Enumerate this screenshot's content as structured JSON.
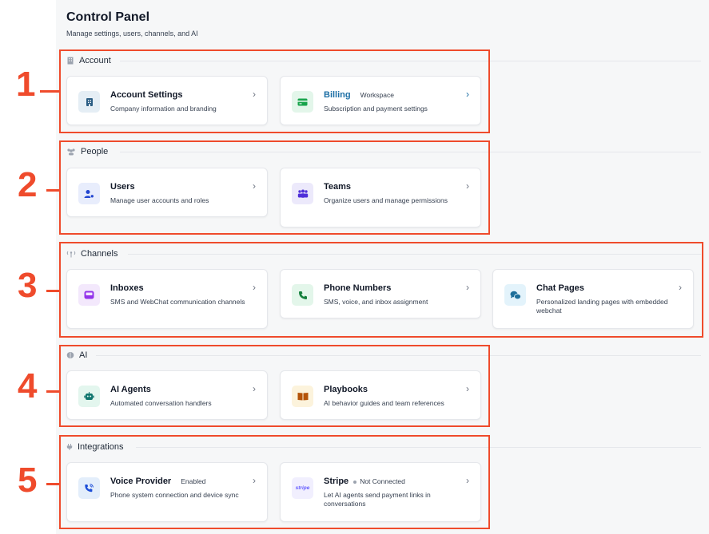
{
  "header": {
    "title": "Control Panel",
    "subtitle": "Manage settings, users, channels, and AI"
  },
  "sections": {
    "account": {
      "label": "Account",
      "cards": [
        {
          "title": "Account Settings",
          "badge": "",
          "desc": "Company information and branding",
          "icon": "building-icon"
        },
        {
          "title": "Billing",
          "badge": "Workspace",
          "desc": "Subscription and payment settings",
          "icon": "credit-card-icon"
        }
      ]
    },
    "people": {
      "label": "People",
      "cards": [
        {
          "title": "Users",
          "desc": "Manage user accounts and roles",
          "icon": "user-gear-icon"
        },
        {
          "title": "Teams",
          "desc": "Organize users and manage permissions",
          "icon": "team-icon"
        }
      ]
    },
    "channels": {
      "label": "Channels",
      "cards": [
        {
          "title": "Inboxes",
          "desc": "SMS and WebChat communication channels",
          "icon": "inbox-icon"
        },
        {
          "title": "Phone Numbers",
          "desc": "SMS, voice, and inbox assignment",
          "icon": "phone-icon"
        },
        {
          "title": "Chat Pages",
          "desc": "Personalized landing pages with embedded webchat",
          "icon": "chat-bubbles-icon"
        }
      ]
    },
    "ai": {
      "label": "AI",
      "cards": [
        {
          "title": "AI Agents",
          "desc": "Automated conversation handlers",
          "icon": "robot-icon"
        },
        {
          "title": "Playbooks",
          "desc": "AI behavior guides and team references",
          "icon": "book-icon"
        }
      ]
    },
    "integrations": {
      "label": "Integrations",
      "cards": [
        {
          "title": "Voice Provider",
          "badge": "Enabled",
          "desc": "Phone system connection and device sync",
          "icon": "phone-wave-icon"
        },
        {
          "title": "Stripe",
          "badge": "Not Connected",
          "desc": "Let AI agents send payment links in conversations",
          "icon": "stripe-logo",
          "logo_text": "stripe"
        }
      ]
    }
  },
  "annotations": {
    "labels": [
      "1",
      "2",
      "3",
      "4",
      "5"
    ],
    "color": "#ef4b2c"
  },
  "colors": {
    "billing_title": "#1d6fa5",
    "stripe_purple": "#635bff"
  }
}
